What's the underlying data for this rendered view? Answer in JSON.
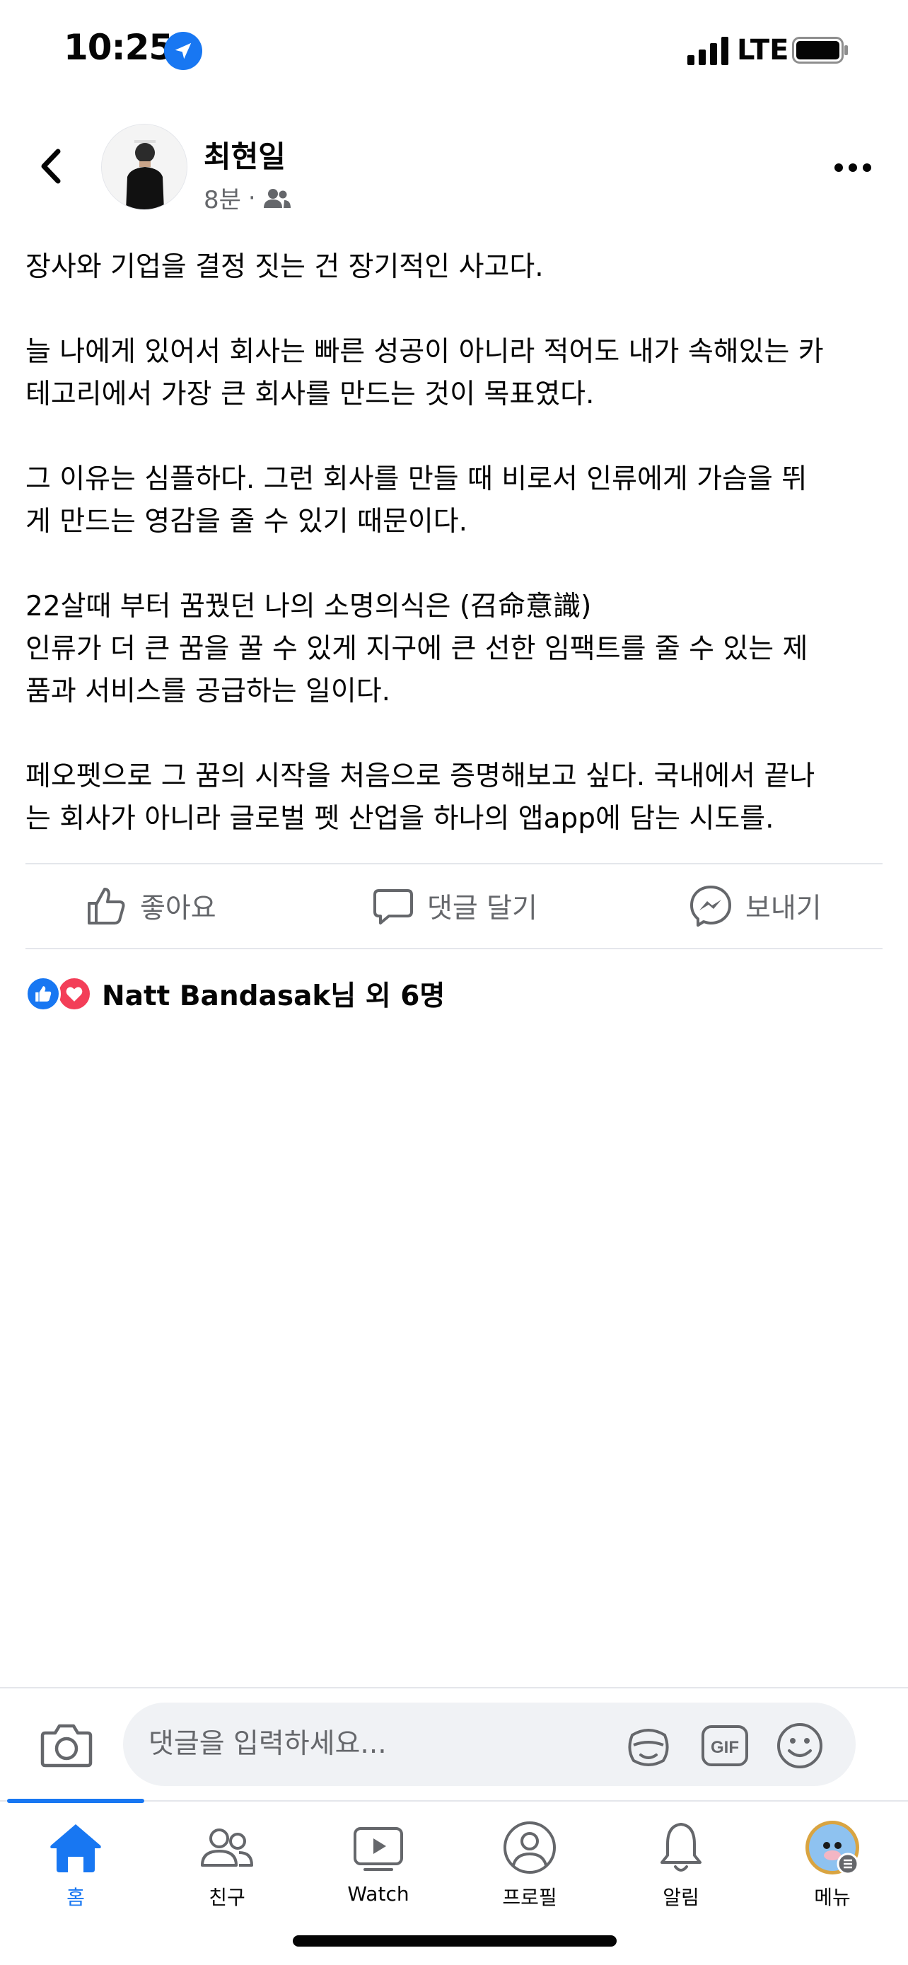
{
  "status_bar": {
    "time": "10:25",
    "network": "LTE",
    "icons": [
      "location-arrow-icon",
      "signal-icon",
      "battery-icon"
    ]
  },
  "post": {
    "author": "최현일",
    "time": "8분",
    "separator": "·",
    "audience_icon": "friends-icon",
    "paragraphs": [
      "장사와 기업을 결정 짓는 건 장기적인 사고다.",
      "늘 나에게 있어서 회사는 빠른 성공이 아니라 적어도 내가 속해있는 카\n테고리에서 가장 큰 회사를 만드는 것이 목표였다.",
      "그 이유는 심플하다. 그런 회사를 만들 때 비로서 인류에게 가슴을 뛰\n게 만드는 영감을 줄 수 있기 때문이다.",
      "22살때 부터 꿈꿨던 나의 소명의식은 (召命意識)\n인류가 더 큰 꿈을 꿀 수 있게 지구에 큰 선한 임팩트를 줄 수 있는 제\n품과 서비스를 공급하는 일이다.",
      "페오펫으로 그 꿈의 시작을 처음으로 증명해보고 싶다. 국내에서 끝나\n는 회사가 아니라 글로벌 펫 산업을 하나의 앱app에 담는 시도를."
    ]
  },
  "actions": {
    "like": "좋아요",
    "comment": "댓글 달기",
    "send": "보내기"
  },
  "reactions": {
    "summary": "Natt Bandasak님 외 6명",
    "types": [
      "like",
      "love"
    ]
  },
  "comment_bar": {
    "placeholder": "댓글을 입력하세요..."
  },
  "tabs": [
    {
      "label": "홈",
      "icon": "home-icon",
      "active": true
    },
    {
      "label": "친구",
      "icon": "friends-icon",
      "active": false
    },
    {
      "label": "Watch",
      "icon": "watch-icon",
      "active": false
    },
    {
      "label": "프로필",
      "icon": "profile-icon",
      "active": false
    },
    {
      "label": "알림",
      "icon": "bell-icon",
      "active": false
    },
    {
      "label": "메뉴",
      "icon": "menu-avatar-icon",
      "active": false
    }
  ],
  "colors": {
    "accent": "#1877f2",
    "secondary_text": "#65676b",
    "love": "#f33e58"
  }
}
